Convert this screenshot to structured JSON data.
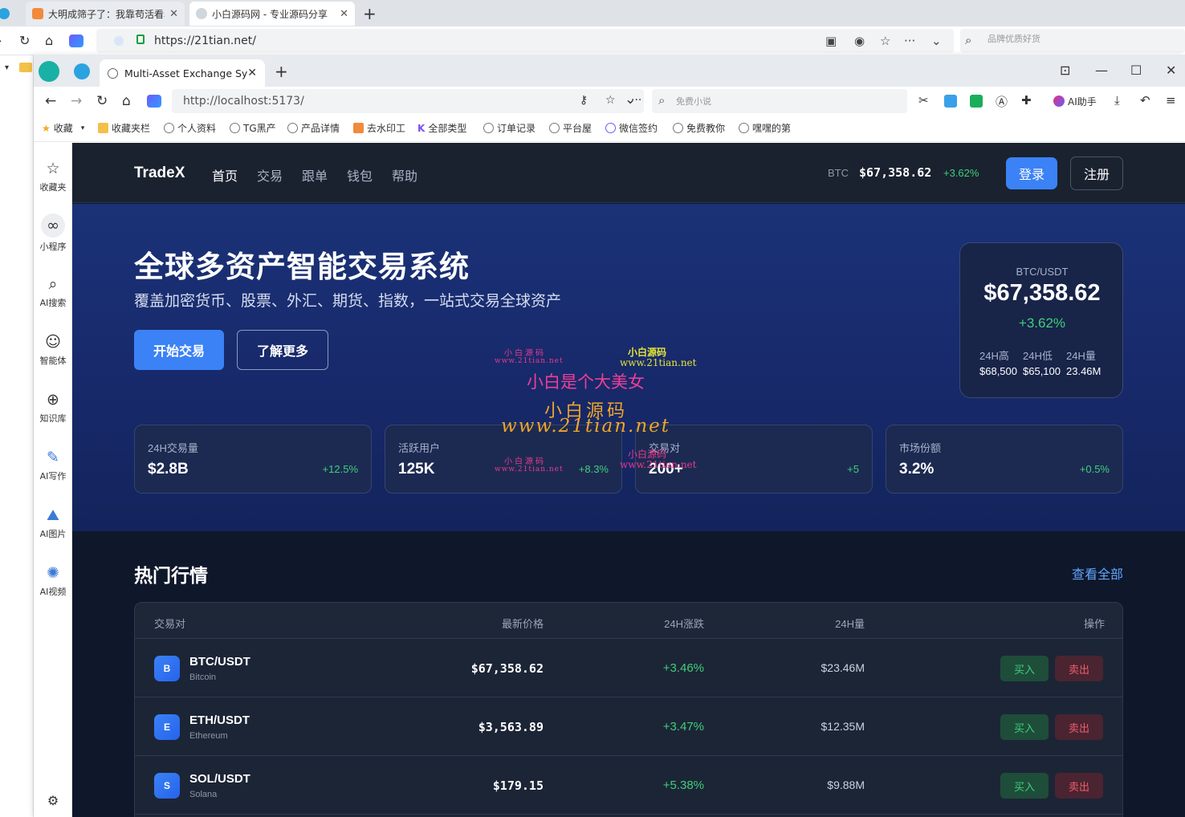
{
  "outer_browser": {
    "tabs": [
      {
        "title": "大明成筛子了：我靠苟活看着"
      },
      {
        "title": "小白源码网 - 专业源码分享"
      }
    ],
    "url": "https://21tian.net/",
    "search_placeholder": "品牌优质好货"
  },
  "inner_browser": {
    "tab_title": "Multi-Asset Exchange Syst",
    "url": "http://localhost:5173/",
    "search_placeholder": "免费小说",
    "ai_assistant": "AI助手",
    "bookmarks": [
      "收藏",
      "收藏夹栏",
      "个人资料",
      "TG黑产",
      "产品详情",
      "去水印工",
      "全部类型",
      "订单记录",
      "平台屋",
      "微信签约",
      "免费教你",
      "嘿嘿的第"
    ],
    "sidebar": [
      "收藏夹",
      "小程序",
      "AI搜索",
      "智能体",
      "知识库",
      "AI写作",
      "AI图片",
      "AI视频"
    ]
  },
  "app": {
    "brand": "TradeX",
    "nav": [
      "首页",
      "交易",
      "跟单",
      "钱包",
      "帮助"
    ],
    "ticker": {
      "symbol": "BTC",
      "price": "$67,358.62",
      "change": "+3.62%"
    },
    "login": "登录",
    "signup": "注册",
    "hero": {
      "title": "全球多资产智能交易系统",
      "subtitle": "覆盖加密货币、股票、外汇、期货、指数，一站式交易全球资产",
      "start_button": "开始交易",
      "more_button": "了解更多"
    },
    "price_card": {
      "pair": "BTC/USDT",
      "price": "$67,358.62",
      "change": "+3.62%",
      "stats": [
        {
          "label": "24H高",
          "value": "$68,500"
        },
        {
          "label": "24H低",
          "value": "$65,100"
        },
        {
          "label": "24H量",
          "value": "23.46M"
        }
      ]
    },
    "stats": [
      {
        "label": "24H交易量",
        "value": "$2.8B",
        "change": "+12.5%"
      },
      {
        "label": "活跃用户",
        "value": "125K",
        "change": "+8.3%"
      },
      {
        "label": "交易对",
        "value": "200+",
        "change": "+5"
      },
      {
        "label": "市场份额",
        "value": "3.2%",
        "change": "+0.5%"
      }
    ],
    "market": {
      "title": "热门行情",
      "view_all": "查看全部",
      "headers": [
        "交易对",
        "最新价格",
        "24H涨跌",
        "24H量",
        "操作"
      ],
      "rows": [
        {
          "icon": "B",
          "pair": "BTC/USDT",
          "name": "Bitcoin",
          "price": "$67,358.62",
          "change": "+3.46%",
          "volume": "$23.46M",
          "buy": "买入",
          "sell": "卖出"
        },
        {
          "icon": "E",
          "pair": "ETH/USDT",
          "name": "Ethereum",
          "price": "$3,563.89",
          "change": "+3.47%",
          "volume": "$12.35M",
          "buy": "买入",
          "sell": "卖出"
        },
        {
          "icon": "S",
          "pair": "SOL/USDT",
          "name": "Solana",
          "price": "$179.15",
          "change": "+5.38%",
          "volume": "$9.88M",
          "buy": "买入",
          "sell": "卖出"
        }
      ]
    }
  },
  "watermark": {
    "small": "小白源码",
    "small_url": "www.21tian.net",
    "main": "小白是个大美女",
    "brand": "小白源码",
    "url": "www.21tian.net"
  },
  "colors": {
    "accent": "#3b82f6",
    "positive": "#3fcf7a",
    "negative": "#ef5b6b",
    "nav_bg": "#1a2230",
    "hero_bg": "#1b3278",
    "page_bg": "#0f172a"
  }
}
